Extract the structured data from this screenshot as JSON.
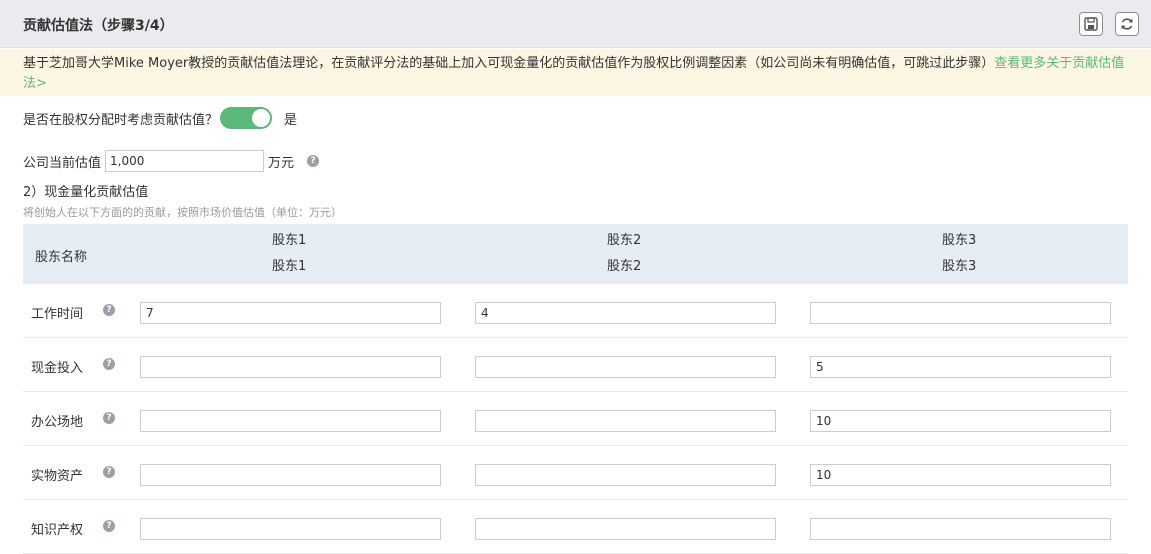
{
  "header": {
    "title": "贡献估值法（步骤3/4）"
  },
  "notice": {
    "text": "基于芝加哥大学Mike Moyer教授的贡献估值法理论，在贡献评分法的基础上加入可现金量化的贡献估值作为股权比例调整因素（如公司尚未有明确估值，可跳过此步骤）",
    "link": "查看更多关于贡献估值法>"
  },
  "toggle": {
    "question": "是否在股权分配时考虑贡献估值？",
    "state": "是"
  },
  "valuation": {
    "label": "公司当前估值",
    "value": "1,000",
    "unit": "万元"
  },
  "section": {
    "title": "2）现金量化贡献估值",
    "subtitle": "将创始人在以下方面的的贡献，按照市场价值估值（单位：万元）"
  },
  "table": {
    "header_label": "股东名称",
    "columns": [
      {
        "name": "股东1",
        "sub": "股东1"
      },
      {
        "name": "股东2",
        "sub": "股东2"
      },
      {
        "name": "股东3",
        "sub": "股东3"
      }
    ],
    "rows": [
      {
        "label": "工作时间",
        "values": [
          "7",
          "4",
          ""
        ]
      },
      {
        "label": "现金投入",
        "values": [
          "",
          "",
          "5"
        ]
      },
      {
        "label": "办公场地",
        "values": [
          "",
          "",
          "10"
        ]
      },
      {
        "label": "实物资产",
        "values": [
          "",
          "",
          "10"
        ]
      },
      {
        "label": "知识产权",
        "values": [
          "",
          "",
          ""
        ]
      }
    ]
  },
  "icons": {
    "save": "save-icon",
    "refresh": "refresh-icon",
    "help": "question-icon"
  },
  "colors": {
    "accent": "#5cb87a",
    "notice_bg": "#fdf6e3",
    "header_bg": "#e9ebef",
    "table_head_bg": "#e6edf4"
  }
}
